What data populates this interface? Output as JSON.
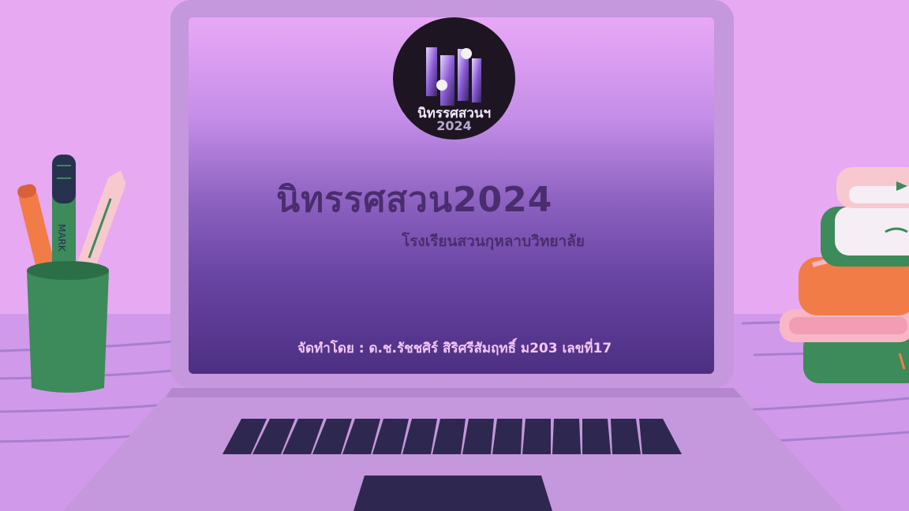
{
  "logo": {
    "line1": "นิทรรศสวนฯ",
    "line2": "2024"
  },
  "screen": {
    "title": "นิทรรศสวน2024",
    "subtitle": "โรงเรียนสวนกุหลาบวิทยาลัย",
    "credit": "จัดทำโดย : ด.ช.รัชชศิร์ สิริศรีสัมฤทธิ์ ม203 เลขที่17"
  },
  "props": {
    "marker_label": "MARK"
  },
  "colors": {
    "background": "#e6a9f2",
    "desk": "#d199ea",
    "laptop_body": "#c597dc",
    "title_text": "#4a2d6e",
    "credit_text": "#f3c6f5",
    "keyboard_keys": "#2e2850",
    "cup": "#3d8a5a",
    "books_orange": "#f27c47",
    "books_green": "#3d8a5a",
    "books_pink": "#f7b7c5"
  },
  "icons": {
    "logo": "nitat-logo-icon",
    "pencil_cup": "pencil-cup-icon",
    "book_stack": "book-stack-icon"
  }
}
